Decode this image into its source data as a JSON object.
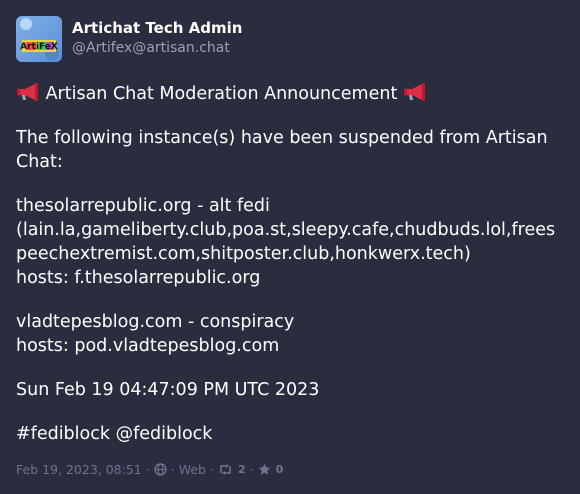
{
  "author": {
    "display_name": "Artichat Tech Admin",
    "handle": "@Artifex@artisan.chat",
    "avatar_text": "ArtiFeX"
  },
  "post": {
    "title_text": "Artisan Chat Moderation Announcement",
    "intro": "The following instance(s) have been suspended from Artisan Chat:",
    "entry1_line1": "thesolarrepublic.org - alt fedi",
    "entry1_line2": "(lain.la,gameliberty.club,poa.st,sleepy.cafe,chudbuds.lol,freespeechextremist.com,shitposter.club,honkwerx.tech)",
    "entry1_hosts": "hosts: f.thesolarrepublic.org",
    "entry2_line1": "vladtepesblog.com - conspiracy",
    "entry2_hosts": "hosts: pod.vladtepesblog.com",
    "date_line": "Sun Feb 19 04:47:09 PM UTC 2023",
    "hashtag": "#fediblock",
    "mention": "@fediblock"
  },
  "meta": {
    "timestamp": "Feb 19, 2023, 08:51",
    "separator": "·",
    "visibility_icon": "globe-icon",
    "client": "Web",
    "boost_icon": "boost-icon",
    "boost_count": "2",
    "favourite_icon": "star-icon",
    "favourite_count": "0"
  },
  "colors": {
    "background": "#292d3e",
    "text": "#ffffff",
    "secondary_text": "#9ba1b9",
    "meta_text": "#6d7391",
    "megaphone_red": "#dd2e44"
  }
}
